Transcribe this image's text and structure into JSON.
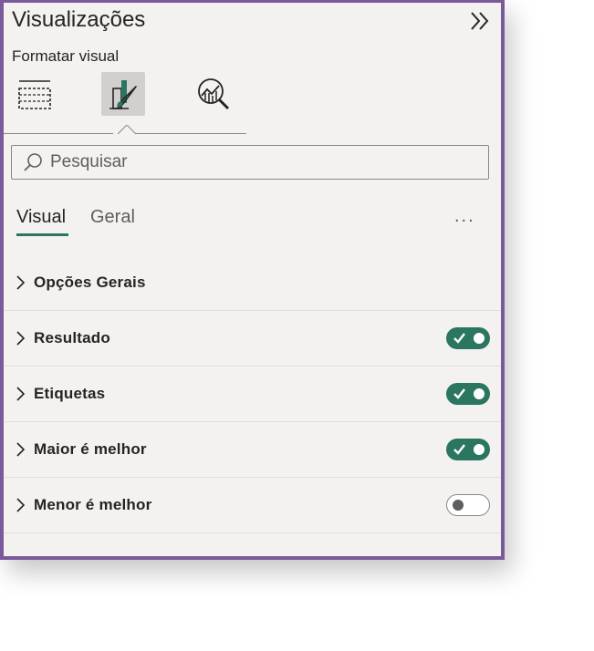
{
  "header": {
    "title": "Visualizações"
  },
  "format": {
    "label": "Formatar visual"
  },
  "search": {
    "placeholder": "Pesquisar"
  },
  "subtabs": [
    {
      "label": "Visual",
      "active": true
    },
    {
      "label": "Geral",
      "active": false
    }
  ],
  "more": {
    "label": "..."
  },
  "sections": [
    {
      "label": "Opções Gerais",
      "toggle": null
    },
    {
      "label": "Resultado",
      "toggle": "on"
    },
    {
      "label": "Etiquetas",
      "toggle": "on"
    },
    {
      "label": "Maior é melhor",
      "toggle": "on"
    },
    {
      "label": "Menor é melhor",
      "toggle": "off"
    }
  ],
  "icons": [
    "double-chevron-right-icon",
    "build-visual-icon",
    "format-visual-icon",
    "analytics-icon",
    "search-icon",
    "chevron-right-icon",
    "checkmark-icon"
  ],
  "colors": {
    "accent": "#2b7660",
    "border": "#7b5a9b",
    "panel_bg": "#f3f2f1"
  }
}
